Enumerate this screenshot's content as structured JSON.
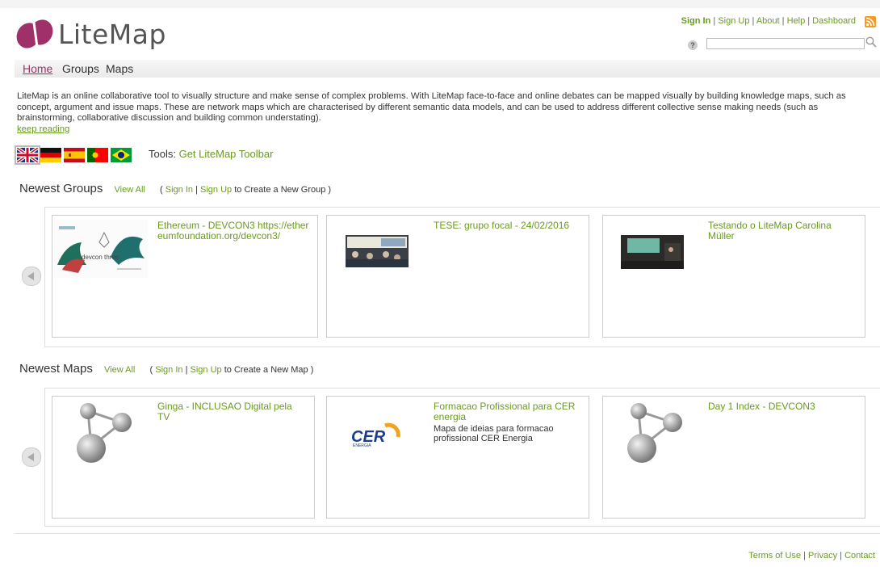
{
  "brand": {
    "name": "LiteMap"
  },
  "toplinks": {
    "signin": "Sign In",
    "signup": "Sign Up",
    "about": "About",
    "help": "Help",
    "dashboard": "Dashboard",
    "sep": "|"
  },
  "search": {
    "placeholder": "",
    "help_symbol": "?"
  },
  "nav": {
    "home": "Home",
    "groups": "Groups",
    "maps": "Maps"
  },
  "intro": {
    "text": "LiteMap is an online collaborative tool to visually structure and make sense of complex problems. With LiteMap face-to-face and online debates can be mapped visually by building knowledge maps, such as concept, argument and issue maps. These are network maps which are characterised by different semantic data models, and can be used to address different collective sense making needs (such as brainstorming, collaborative discussion and building common understating).",
    "keep_reading": "keep reading"
  },
  "tools": {
    "label": "Tools:",
    "link": "Get LiteMap Toolbar"
  },
  "groups_section": {
    "title": "Newest Groups",
    "view_all": "View All",
    "open": "(",
    "signin": "Sign In",
    "sep": "|",
    "signup": "Sign Up",
    "rest": "to Create a New Group )",
    "items": [
      {
        "title": "Ethereum - DEVCON3 https://ethereumfoundation.org/devcon3/",
        "thumb_text": "devcon three"
      },
      {
        "title": "TESE: grupo focal - 24/02/2016"
      },
      {
        "title": "Testando o LiteMap Carolina Müller"
      }
    ]
  },
  "maps_section": {
    "title": "Newest Maps",
    "view_all": "View All",
    "open": "(",
    "signin": "Sign In",
    "sep": "|",
    "signup": "Sign Up",
    "rest": "to Create a New Map )",
    "items": [
      {
        "title": "Ginga - INCLUSAO Digital pela TV",
        "desc": ""
      },
      {
        "title": "Formacao Profissional para CER energia",
        "desc": "Mapa de ideias para formacao profissional CER Energia",
        "logo_text": "CER",
        "logo_sub": "ENERGIA"
      },
      {
        "title": "Day 1 Index - DEVCON3",
        "desc": ""
      }
    ]
  },
  "footer": {
    "terms": "Terms of Use",
    "privacy": "Privacy",
    "contact": "Contact",
    "sep": "|"
  },
  "colors": {
    "accent": "#6a9a1f",
    "brand": "#a0306a",
    "text": "#333333"
  }
}
